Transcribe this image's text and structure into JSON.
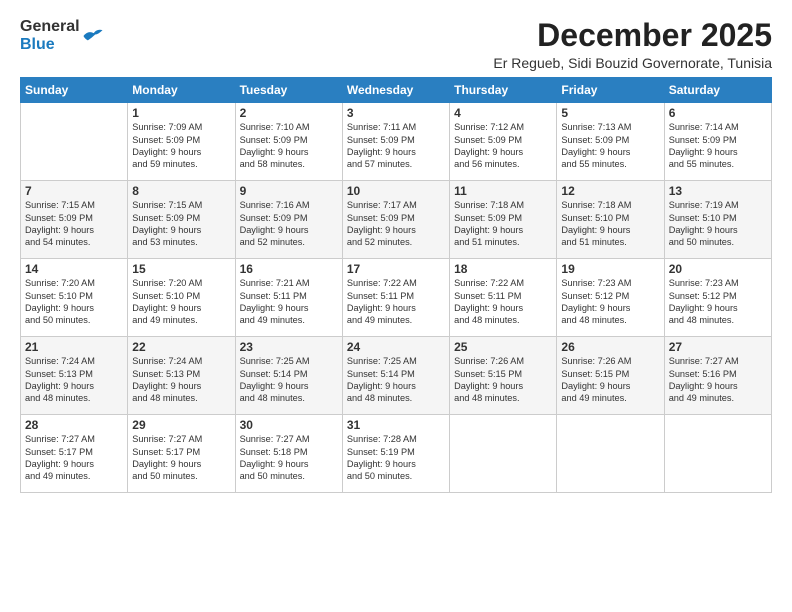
{
  "header": {
    "logo_general": "General",
    "logo_blue": "Blue",
    "month_title": "December 2025",
    "subtitle": "Er Regueb, Sidi Bouzid Governorate, Tunisia"
  },
  "columns": [
    "Sunday",
    "Monday",
    "Tuesday",
    "Wednesday",
    "Thursday",
    "Friday",
    "Saturday"
  ],
  "weeks": [
    [
      {
        "day": "",
        "lines": []
      },
      {
        "day": "1",
        "lines": [
          "Sunrise: 7:09 AM",
          "Sunset: 5:09 PM",
          "Daylight: 9 hours",
          "and 59 minutes."
        ]
      },
      {
        "day": "2",
        "lines": [
          "Sunrise: 7:10 AM",
          "Sunset: 5:09 PM",
          "Daylight: 9 hours",
          "and 58 minutes."
        ]
      },
      {
        "day": "3",
        "lines": [
          "Sunrise: 7:11 AM",
          "Sunset: 5:09 PM",
          "Daylight: 9 hours",
          "and 57 minutes."
        ]
      },
      {
        "day": "4",
        "lines": [
          "Sunrise: 7:12 AM",
          "Sunset: 5:09 PM",
          "Daylight: 9 hours",
          "and 56 minutes."
        ]
      },
      {
        "day": "5",
        "lines": [
          "Sunrise: 7:13 AM",
          "Sunset: 5:09 PM",
          "Daylight: 9 hours",
          "and 55 minutes."
        ]
      },
      {
        "day": "6",
        "lines": [
          "Sunrise: 7:14 AM",
          "Sunset: 5:09 PM",
          "Daylight: 9 hours",
          "and 55 minutes."
        ]
      }
    ],
    [
      {
        "day": "7",
        "lines": [
          "Sunrise: 7:15 AM",
          "Sunset: 5:09 PM",
          "Daylight: 9 hours",
          "and 54 minutes."
        ]
      },
      {
        "day": "8",
        "lines": [
          "Sunrise: 7:15 AM",
          "Sunset: 5:09 PM",
          "Daylight: 9 hours",
          "and 53 minutes."
        ]
      },
      {
        "day": "9",
        "lines": [
          "Sunrise: 7:16 AM",
          "Sunset: 5:09 PM",
          "Daylight: 9 hours",
          "and 52 minutes."
        ]
      },
      {
        "day": "10",
        "lines": [
          "Sunrise: 7:17 AM",
          "Sunset: 5:09 PM",
          "Daylight: 9 hours",
          "and 52 minutes."
        ]
      },
      {
        "day": "11",
        "lines": [
          "Sunrise: 7:18 AM",
          "Sunset: 5:09 PM",
          "Daylight: 9 hours",
          "and 51 minutes."
        ]
      },
      {
        "day": "12",
        "lines": [
          "Sunrise: 7:18 AM",
          "Sunset: 5:10 PM",
          "Daylight: 9 hours",
          "and 51 minutes."
        ]
      },
      {
        "day": "13",
        "lines": [
          "Sunrise: 7:19 AM",
          "Sunset: 5:10 PM",
          "Daylight: 9 hours",
          "and 50 minutes."
        ]
      }
    ],
    [
      {
        "day": "14",
        "lines": [
          "Sunrise: 7:20 AM",
          "Sunset: 5:10 PM",
          "Daylight: 9 hours",
          "and 50 minutes."
        ]
      },
      {
        "day": "15",
        "lines": [
          "Sunrise: 7:20 AM",
          "Sunset: 5:10 PM",
          "Daylight: 9 hours",
          "and 49 minutes."
        ]
      },
      {
        "day": "16",
        "lines": [
          "Sunrise: 7:21 AM",
          "Sunset: 5:11 PM",
          "Daylight: 9 hours",
          "and 49 minutes."
        ]
      },
      {
        "day": "17",
        "lines": [
          "Sunrise: 7:22 AM",
          "Sunset: 5:11 PM",
          "Daylight: 9 hours",
          "and 49 minutes."
        ]
      },
      {
        "day": "18",
        "lines": [
          "Sunrise: 7:22 AM",
          "Sunset: 5:11 PM",
          "Daylight: 9 hours",
          "and 48 minutes."
        ]
      },
      {
        "day": "19",
        "lines": [
          "Sunrise: 7:23 AM",
          "Sunset: 5:12 PM",
          "Daylight: 9 hours",
          "and 48 minutes."
        ]
      },
      {
        "day": "20",
        "lines": [
          "Sunrise: 7:23 AM",
          "Sunset: 5:12 PM",
          "Daylight: 9 hours",
          "and 48 minutes."
        ]
      }
    ],
    [
      {
        "day": "21",
        "lines": [
          "Sunrise: 7:24 AM",
          "Sunset: 5:13 PM",
          "Daylight: 9 hours",
          "and 48 minutes."
        ]
      },
      {
        "day": "22",
        "lines": [
          "Sunrise: 7:24 AM",
          "Sunset: 5:13 PM",
          "Daylight: 9 hours",
          "and 48 minutes."
        ]
      },
      {
        "day": "23",
        "lines": [
          "Sunrise: 7:25 AM",
          "Sunset: 5:14 PM",
          "Daylight: 9 hours",
          "and 48 minutes."
        ]
      },
      {
        "day": "24",
        "lines": [
          "Sunrise: 7:25 AM",
          "Sunset: 5:14 PM",
          "Daylight: 9 hours",
          "and 48 minutes."
        ]
      },
      {
        "day": "25",
        "lines": [
          "Sunrise: 7:26 AM",
          "Sunset: 5:15 PM",
          "Daylight: 9 hours",
          "and 48 minutes."
        ]
      },
      {
        "day": "26",
        "lines": [
          "Sunrise: 7:26 AM",
          "Sunset: 5:15 PM",
          "Daylight: 9 hours",
          "and 49 minutes."
        ]
      },
      {
        "day": "27",
        "lines": [
          "Sunrise: 7:27 AM",
          "Sunset: 5:16 PM",
          "Daylight: 9 hours",
          "and 49 minutes."
        ]
      }
    ],
    [
      {
        "day": "28",
        "lines": [
          "Sunrise: 7:27 AM",
          "Sunset: 5:17 PM",
          "Daylight: 9 hours",
          "and 49 minutes."
        ]
      },
      {
        "day": "29",
        "lines": [
          "Sunrise: 7:27 AM",
          "Sunset: 5:17 PM",
          "Daylight: 9 hours",
          "and 50 minutes."
        ]
      },
      {
        "day": "30",
        "lines": [
          "Sunrise: 7:27 AM",
          "Sunset: 5:18 PM",
          "Daylight: 9 hours",
          "and 50 minutes."
        ]
      },
      {
        "day": "31",
        "lines": [
          "Sunrise: 7:28 AM",
          "Sunset: 5:19 PM",
          "Daylight: 9 hours",
          "and 50 minutes."
        ]
      },
      {
        "day": "",
        "lines": []
      },
      {
        "day": "",
        "lines": []
      },
      {
        "day": "",
        "lines": []
      }
    ]
  ]
}
